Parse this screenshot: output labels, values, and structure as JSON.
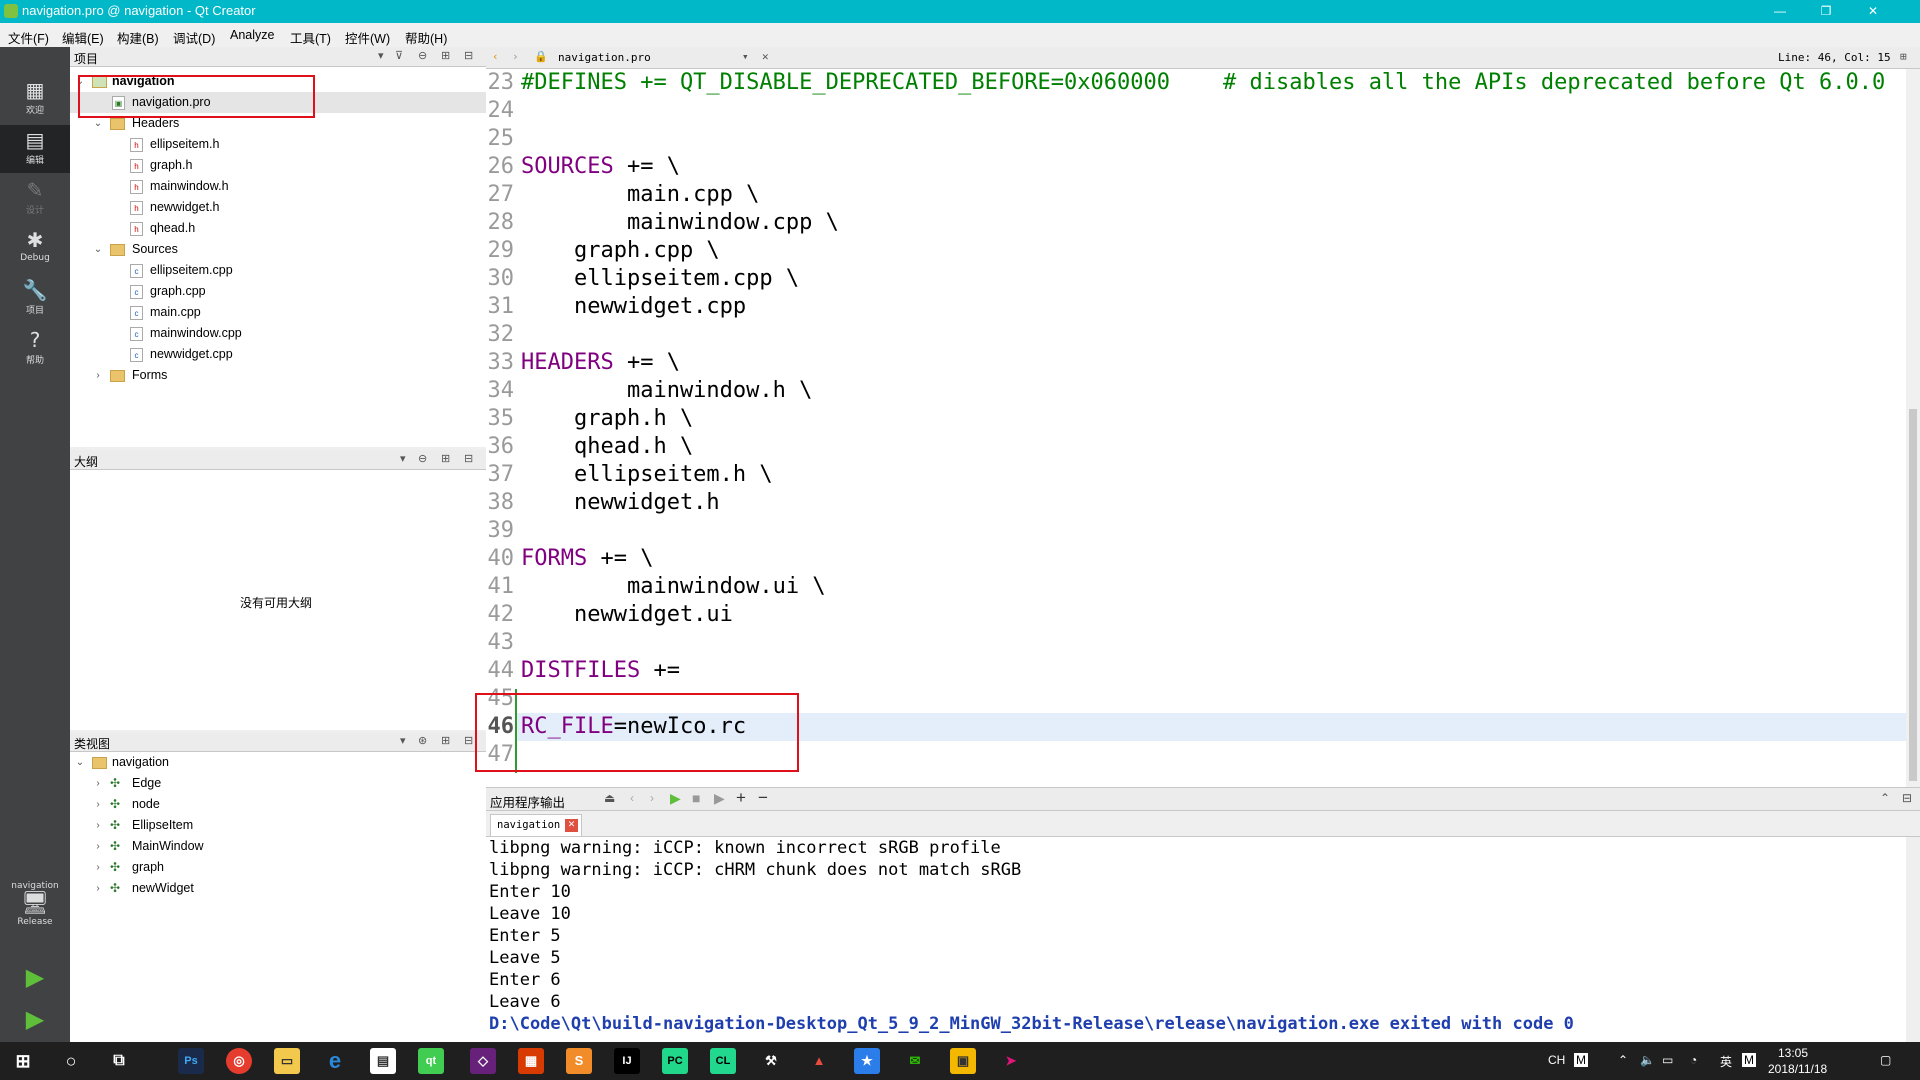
{
  "window": {
    "title": "navigation.pro @ navigation - Qt Creator",
    "minimize": "—",
    "restore": "❐",
    "close": "✕"
  },
  "menu": [
    "文件(F)",
    "编辑(E)",
    "构建(B)",
    "调试(D)",
    "Analyze",
    "工具(T)",
    "控件(W)",
    "帮助(H)"
  ],
  "modes": [
    {
      "label": "欢迎",
      "icon": "grid-icon"
    },
    {
      "label": "编辑",
      "icon": "edit-icon"
    },
    {
      "label": "设计",
      "icon": "pencil-icon"
    },
    {
      "label": "Debug",
      "icon": "bug-icon"
    },
    {
      "label": "项目",
      "icon": "wrench-icon"
    },
    {
      "label": "帮助",
      "icon": "help-icon"
    }
  ],
  "kit": {
    "project": "navigation",
    "config": "Release"
  },
  "projects_pane": {
    "title": "项目",
    "root": "navigation",
    "pro_file": "navigation.pro",
    "headers_label": "Headers",
    "headers": [
      "ellipseitem.h",
      "graph.h",
      "mainwindow.h",
      "newwidget.h",
      "qhead.h"
    ],
    "sources_label": "Sources",
    "sources": [
      "ellipseitem.cpp",
      "graph.cpp",
      "main.cpp",
      "mainwindow.cpp",
      "newwidget.cpp"
    ],
    "forms_label": "Forms"
  },
  "outline_pane": {
    "title": "大纲",
    "empty_text": "没有可用大纲"
  },
  "class_pane": {
    "title": "类视图",
    "root": "navigation",
    "classes": [
      "Edge",
      "node",
      "EllipseItem",
      "MainWindow",
      "graph",
      "newWidget"
    ]
  },
  "editor": {
    "file_tab": "navigation.pro",
    "cursor": "Line: 46, Col: 15",
    "lines": [
      {
        "n": "23",
        "segs": [
          {
            "t": "#DEFINES += QT_DISABLE_DEPRECATED_BEFORE=0x060000    # disables all the APIs deprecated before Qt 6.0.0",
            "c": "cm"
          }
        ]
      },
      {
        "n": "24",
        "segs": []
      },
      {
        "n": "25",
        "segs": []
      },
      {
        "n": "26",
        "segs": [
          {
            "t": "SOURCES",
            "c": "kw"
          },
          {
            "t": " += \\",
            "c": ""
          }
        ]
      },
      {
        "n": "27",
        "segs": [
          {
            "t": "        main.cpp \\",
            "c": ""
          }
        ]
      },
      {
        "n": "28",
        "segs": [
          {
            "t": "        mainwindow.cpp \\",
            "c": ""
          }
        ]
      },
      {
        "n": "29",
        "segs": [
          {
            "t": "    graph.cpp \\",
            "c": ""
          }
        ]
      },
      {
        "n": "30",
        "segs": [
          {
            "t": "    ellipseitem.cpp \\",
            "c": ""
          }
        ]
      },
      {
        "n": "31",
        "segs": [
          {
            "t": "    newwidget.cpp",
            "c": ""
          }
        ]
      },
      {
        "n": "32",
        "segs": []
      },
      {
        "n": "33",
        "segs": [
          {
            "t": "HEADERS",
            "c": "kw"
          },
          {
            "t": " += \\",
            "c": ""
          }
        ]
      },
      {
        "n": "34",
        "segs": [
          {
            "t": "        mainwindow.h \\",
            "c": ""
          }
        ]
      },
      {
        "n": "35",
        "segs": [
          {
            "t": "    graph.h \\",
            "c": ""
          }
        ]
      },
      {
        "n": "36",
        "segs": [
          {
            "t": "    qhead.h \\",
            "c": ""
          }
        ]
      },
      {
        "n": "37",
        "segs": [
          {
            "t": "    ellipseitem.h \\",
            "c": ""
          }
        ]
      },
      {
        "n": "38",
        "segs": [
          {
            "t": "    newwidget.h",
            "c": ""
          }
        ]
      },
      {
        "n": "39",
        "segs": []
      },
      {
        "n": "40",
        "segs": [
          {
            "t": "FORMS",
            "c": "kw"
          },
          {
            "t": " += \\",
            "c": ""
          }
        ]
      },
      {
        "n": "41",
        "segs": [
          {
            "t": "        mainwindow.ui \\",
            "c": ""
          }
        ]
      },
      {
        "n": "42",
        "segs": [
          {
            "t": "    newwidget.ui",
            "c": ""
          }
        ]
      },
      {
        "n": "43",
        "segs": []
      },
      {
        "n": "44",
        "segs": [
          {
            "t": "DISTFILES",
            "c": "kw"
          },
          {
            "t": " +=",
            "c": ""
          }
        ]
      },
      {
        "n": "45",
        "segs": []
      },
      {
        "n": "46",
        "segs": [
          {
            "t": "RC_FILE",
            "c": "kw"
          },
          {
            "t": "=newIco.rc",
            "c": ""
          }
        ]
      },
      {
        "n": "47",
        "segs": []
      }
    ]
  },
  "output": {
    "title": "应用程序输出",
    "tab": "navigation",
    "lines": [
      "libpng warning: iCCP: known incorrect sRGB profile",
      "libpng warning: iCCP: cHRM chunk does not match sRGB",
      "Enter 10",
      "Leave 10",
      "Enter 5",
      "Leave 5",
      "Enter 6",
      "Leave 6"
    ],
    "exit_line": "D:\\Code\\Qt\\build-navigation-Desktop_Qt_5_9_2_MinGW_32bit-Release\\release\\navigation.exe exited with code 0"
  },
  "taskbar": {
    "ime": "CH",
    "lang": "英",
    "time": "13:05",
    "date": "2018/11/18"
  }
}
